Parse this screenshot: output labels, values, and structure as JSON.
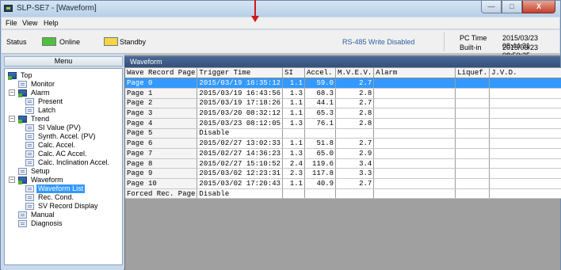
{
  "window": {
    "title": "SLP-SE7 - [Waveform]",
    "buttons": {
      "minimize": "—",
      "maximize": "□",
      "close": "X"
    }
  },
  "menu": [
    "File",
    "View",
    "Help"
  ],
  "status": {
    "label": "Status",
    "online": "Online",
    "standby": "Standby",
    "rs485": "RS-485 Write Disabled",
    "pc_time_label": "PC Time",
    "pc_time": "2015/03/23 08:44:31",
    "builtin_label": "Built-in",
    "builtin_time": "2015/03/23 08:50:25",
    "colors": {
      "online": "#4ec13c",
      "standby": "#f1d648"
    }
  },
  "sidebar": {
    "header": "Menu",
    "tree": [
      {
        "label": "Top",
        "icon": "folder-icon"
      },
      {
        "label": "Monitor",
        "icon": "page-icon"
      },
      {
        "label": "Alarm",
        "icon": "folder-icon"
      },
      {
        "label": "Present",
        "icon": "page-icon"
      },
      {
        "label": "Latch",
        "icon": "page-icon"
      },
      {
        "label": "Trend",
        "icon": "folder-icon"
      },
      {
        "label": "SI Value (PV)",
        "icon": "page-icon"
      },
      {
        "label": "Synth. Accel. (PV)",
        "icon": "page-icon"
      },
      {
        "label": "Calc. Accel.",
        "icon": "page-icon"
      },
      {
        "label": "Calc. AC Accel.",
        "icon": "page-icon"
      },
      {
        "label": "Calc. Inclination Accel.",
        "icon": "page-icon"
      },
      {
        "label": "Setup",
        "icon": "page-icon"
      },
      {
        "label": "Waveform",
        "icon": "folder-icon"
      },
      {
        "label": "Waveform List",
        "icon": "page-icon",
        "selected": true
      },
      {
        "label": "Rec. Cond.",
        "icon": "page-icon"
      },
      {
        "label": "SV Record Display",
        "icon": "page-icon"
      },
      {
        "label": "Manual",
        "icon": "page-icon"
      },
      {
        "label": "Diagnosis",
        "icon": "page-icon"
      }
    ]
  },
  "main": {
    "header": "Waveform",
    "columns": [
      "Wave Record Page",
      "Trigger Time",
      "SI",
      "Accel.",
      "M.V.E.V.",
      "Alarm",
      "Liquef.",
      "J.V.D."
    ],
    "rows": [
      [
        "Page 0",
        "2015/03/19 16:35:12",
        "1.1",
        "59.0",
        "2.7",
        "",
        "",
        ""
      ],
      [
        "Page 1",
        "2015/03/19 16:43:56",
        "1.3",
        "68.3",
        "2.8",
        "",
        "",
        ""
      ],
      [
        "Page 2",
        "2015/03/19 17:18:26",
        "1.1",
        "44.1",
        "2.7",
        "",
        "",
        ""
      ],
      [
        "Page 3",
        "2015/03/20 08:32:12",
        "1.1",
        "65.3",
        "2.8",
        "",
        "",
        ""
      ],
      [
        "Page 4",
        "2015/03/23 08:12:05",
        "1.3",
        "76.1",
        "2.8",
        "",
        "",
        ""
      ],
      [
        "Page 5",
        "Disable",
        "",
        "",
        "",
        "",
        "",
        ""
      ],
      [
        "Page 6",
        "2015/02/27 13:02:33",
        "1.1",
        "51.8",
        "2.7",
        "",
        "",
        ""
      ],
      [
        "Page 7",
        "2015/02/27 14:36:23",
        "1.3",
        "65.0",
        "2.9",
        "",
        "",
        ""
      ],
      [
        "Page 8",
        "2015/02/27 15:10:52",
        "2.4",
        "119.6",
        "3.4",
        "",
        "",
        ""
      ],
      [
        "Page 9",
        "2015/03/02 12:23:31",
        "2.3",
        "117.8",
        "3.3",
        "",
        "",
        ""
      ],
      [
        "Page 10",
        "2015/03/02 17:20:43",
        "1.1",
        "40.9",
        "2.7",
        "",
        "",
        ""
      ],
      [
        "Forced Rec. Page",
        "Disable",
        "",
        "",
        "",
        "",
        "",
        ""
      ]
    ],
    "selected_row": 0
  },
  "annotation": {
    "color": "#d01818"
  }
}
